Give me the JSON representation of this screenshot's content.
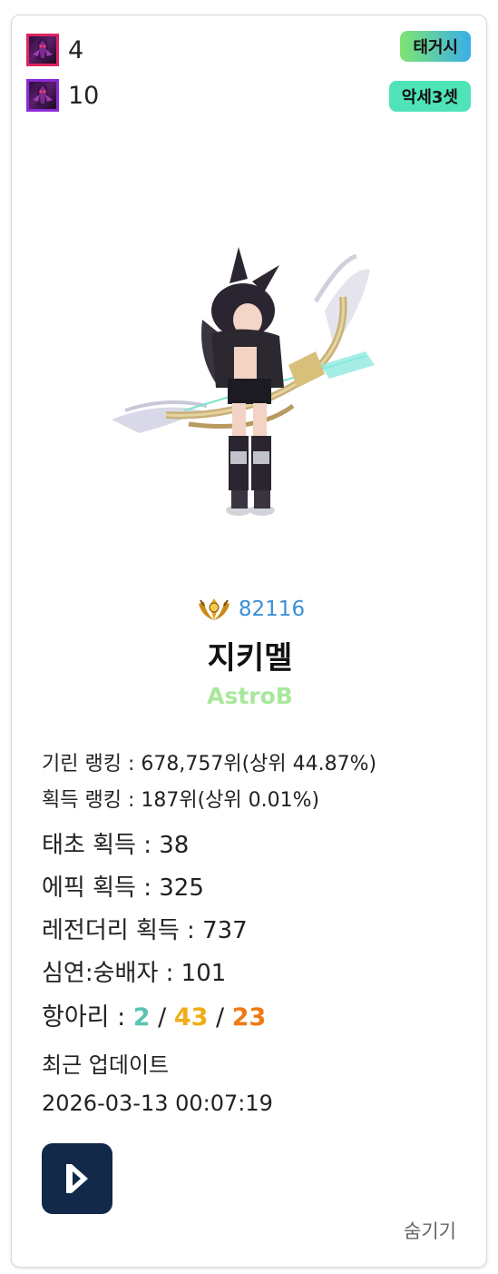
{
  "items": [
    {
      "count": "4",
      "icon": "item-red-icon"
    },
    {
      "count": "10",
      "icon": "item-purple-icon"
    }
  ],
  "tags": [
    "태거시",
    "악세3셋"
  ],
  "profile": {
    "fame": "82116",
    "name": "지키멜",
    "class": "AstroB"
  },
  "rankings": {
    "kirin": "기린 랭킹 : 678,757위(상위 44.87%)",
    "acquire": "획득 랭킹 : 187위(상위 0.01%)"
  },
  "stats": {
    "primeval": "태초 획득 : 38",
    "epic": "에픽 획득 : 325",
    "legendary": "레전더리 획득 : 737",
    "abyss": "심연:숭배자 : 101"
  },
  "jar": {
    "label": "항아리 : ",
    "v1": "2",
    "v2": "43",
    "v3": "23",
    "sep": " / "
  },
  "update": {
    "label": "최근 업데이트",
    "time": "2026-03-13 00:07:19"
  },
  "hide_label": "숨기기",
  "colors": {
    "fame": "#3a8fd8",
    "class": "#a9e89c",
    "jar1": "#5cc4b4",
    "jar2": "#f0ad16",
    "jar3": "#ef7a17",
    "app_bg": "#12294a"
  }
}
